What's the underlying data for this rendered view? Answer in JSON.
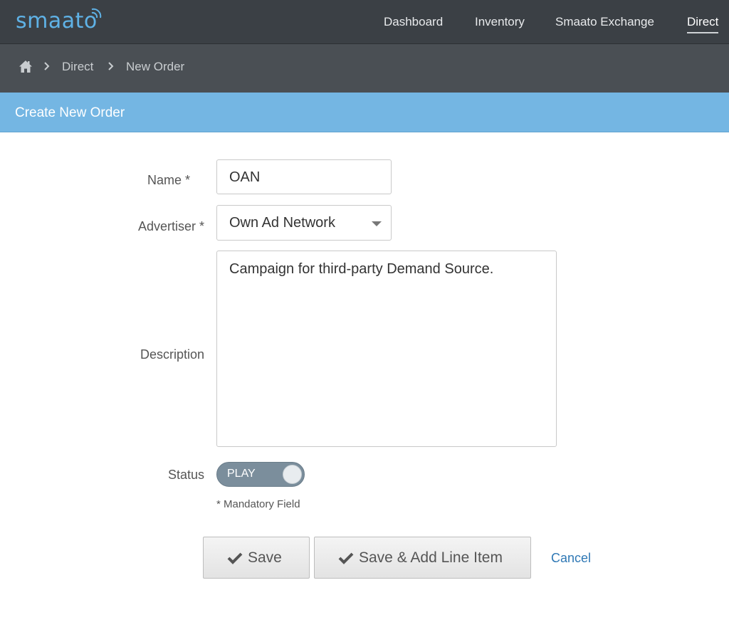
{
  "header": {
    "logo_text": "smaato",
    "nav": [
      "Dashboard",
      "Inventory",
      "Smaato Exchange",
      "Direct"
    ],
    "active_nav": "Direct"
  },
  "breadcrumb": {
    "items": [
      "Direct",
      "New Order"
    ]
  },
  "panel": {
    "title": "Create New Order"
  },
  "form": {
    "name_label": "Name  *",
    "name_value": "OAN",
    "advertiser_label": "Advertiser  *",
    "advertiser_value": "Own Ad Network",
    "description_label": "Description",
    "description_value": "Campaign for third-party Demand Source.",
    "status_label": "Status",
    "status_value": "PLAY",
    "mandatory_note": "* Mandatory Field"
  },
  "actions": {
    "save_label": "Save",
    "save_add_label": "Save & Add Line Item",
    "cancel_label": "Cancel"
  },
  "colors": {
    "topbar": "#3b4045",
    "breadcrumb_bar": "#4a4f54",
    "panel_header": "#74b6e3",
    "logo": "#5fb2e6",
    "link": "#2f78b5",
    "toggle": "#7b8e9c"
  }
}
